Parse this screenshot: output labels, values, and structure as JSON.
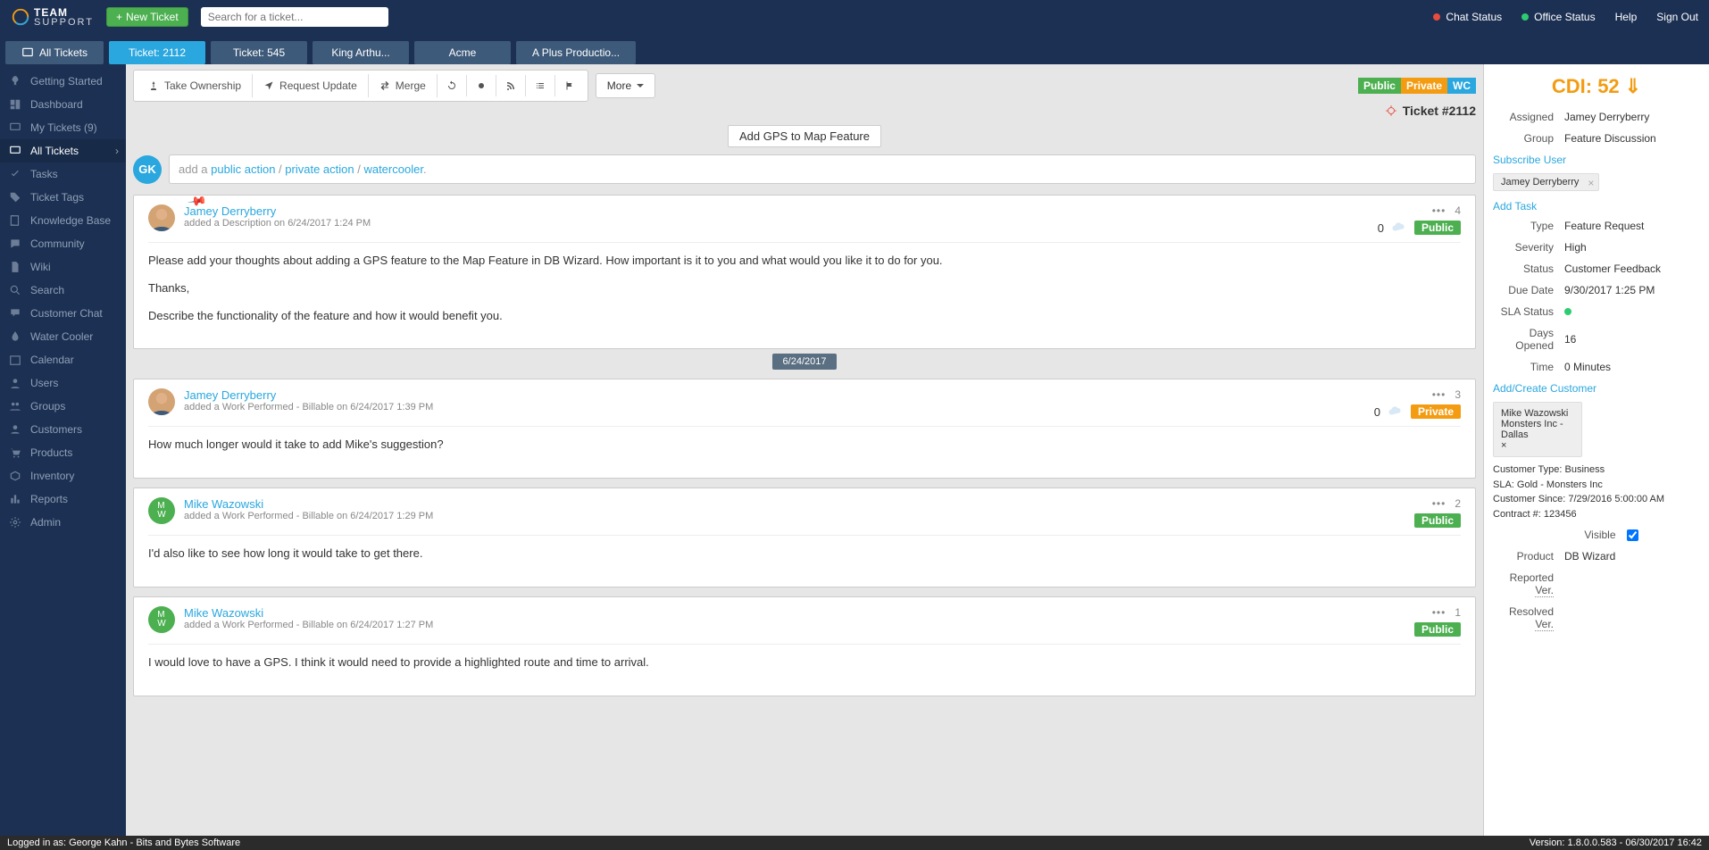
{
  "header": {
    "new_ticket": "New Ticket",
    "search_placeholder": "Search for a ticket...",
    "chat_status": "Chat Status",
    "office_status": "Office Status",
    "help": "Help",
    "signout": "Sign Out"
  },
  "tabs": [
    {
      "label": "All Tickets",
      "active": false,
      "icon": true
    },
    {
      "label": "Ticket: 2112",
      "active": true
    },
    {
      "label": "Ticket: 545",
      "active": false
    },
    {
      "label": "King Arthu...",
      "active": false
    },
    {
      "label": "Acme",
      "active": false
    },
    {
      "label": "A Plus Productio...",
      "active": false
    }
  ],
  "sidebar": [
    {
      "label": "Getting Started",
      "icon": "rocket"
    },
    {
      "label": "Dashboard",
      "icon": "dash"
    },
    {
      "label": "My Tickets (9)",
      "icon": "monitor"
    },
    {
      "label": "All Tickets",
      "icon": "monitor",
      "active": true
    },
    {
      "label": "Tasks",
      "icon": "check"
    },
    {
      "label": "Ticket Tags",
      "icon": "tag"
    },
    {
      "label": "Knowledge Base",
      "icon": "book"
    },
    {
      "label": "Community",
      "icon": "comment"
    },
    {
      "label": "Wiki",
      "icon": "file"
    },
    {
      "label": "Search",
      "icon": "search"
    },
    {
      "label": "Customer Chat",
      "icon": "chat"
    },
    {
      "label": "Water Cooler",
      "icon": "drop"
    },
    {
      "label": "Calendar",
      "icon": "cal"
    },
    {
      "label": "Users",
      "icon": "user"
    },
    {
      "label": "Groups",
      "icon": "group"
    },
    {
      "label": "Customers",
      "icon": "cust"
    },
    {
      "label": "Products",
      "icon": "cart"
    },
    {
      "label": "Inventory",
      "icon": "inv"
    },
    {
      "label": "Reports",
      "icon": "bar"
    },
    {
      "label": "Admin",
      "icon": "gear"
    }
  ],
  "toolbar": {
    "take_ownership": "Take Ownership",
    "request_update": "Request Update",
    "merge": "Merge",
    "more": "More"
  },
  "status_tags": {
    "public": "Public",
    "private": "Private",
    "wc": "WC"
  },
  "ticket_id": "Ticket #2112",
  "ticket_title": "Add GPS to Map Feature",
  "add_action": {
    "prefix": "add a ",
    "public": "public action",
    "sep1": " / ",
    "private": "private action",
    "sep2": " / ",
    "wc": "watercooler",
    "suffix": "."
  },
  "avatar_initials": "GK",
  "date_sep": "6/24/2017",
  "comments": [
    {
      "author": "Jamey Derryberry",
      "meta": "added a Description on 6/24/2017 1:24 PM",
      "count": "4",
      "votes": "0",
      "badge": "public",
      "avatar": "photo",
      "pinned": true,
      "body": [
        "Please add your thoughts about adding a GPS feature to the Map Feature in DB Wizard.  How important is it to you and what would you like it to do for you.",
        "Thanks,",
        "Describe the functionality of the feature and how it would benefit you."
      ]
    },
    {
      "author": "Jamey Derryberry",
      "meta": "added a Work Performed - Billable on 6/24/2017 1:39 PM",
      "count": "3",
      "votes": "0",
      "badge": "private",
      "avatar": "photo",
      "body": [
        "How much longer would it take to add Mike's suggestion?"
      ]
    },
    {
      "author": "Mike Wazowski",
      "meta": "added a Work Performed - Billable on 6/24/2017 1:29 PM",
      "count": "2",
      "badge": "public",
      "avatar": "MW",
      "body": [
        "I'd also like to see how long it would take to get there."
      ]
    },
    {
      "author": "Mike Wazowski",
      "meta": "added a Work Performed - Billable on 6/24/2017 1:27 PM",
      "count": "1",
      "badge": "public",
      "avatar": "MW",
      "body": [
        "I would love to have a GPS.  I think it would need to provide a highlighted route and time to arrival."
      ]
    }
  ],
  "right": {
    "cdi": "CDI: 52",
    "assigned_l": "Assigned",
    "assigned_v": "Jamey Derryberry",
    "group_l": "Group",
    "group_v": "Feature Discussion",
    "subscribe": "Subscribe User",
    "sub_chip": "Jamey Derryberry",
    "add_task": "Add Task",
    "type_l": "Type",
    "type_v": "Feature Request",
    "severity_l": "Severity",
    "severity_v": "High",
    "status_l": "Status",
    "status_v": "Customer Feedback",
    "due_l": "Due Date",
    "due_v": "9/30/2017 1:25 PM",
    "sla_l": "SLA Status",
    "days_l": "Days Opened",
    "days_v": "16",
    "time_l": "Time",
    "time_v": "0 Minutes",
    "add_cust": "Add/Create Customer",
    "cust_name": "Mike Wazowski",
    "cust_co": "Monsters Inc - Dallas",
    "cust_type": "Customer Type: Business",
    "cust_sla": "SLA: Gold - Monsters Inc",
    "cust_since": "Customer Since: 7/29/2016 5:00:00 AM",
    "cust_contract": "Contract #: 123456",
    "visible_l": "Visible",
    "product_l": "Product",
    "product_v": "DB Wizard",
    "reported_l": "Reported ",
    "reported_v": "Ver.",
    "resolved_l": "Resolved ",
    "resolved_v": "Ver."
  },
  "footer": {
    "left": "Logged in as: George Kahn - Bits and Bytes Software",
    "right": "Version: 1.8.0.0.583 - 06/30/2017 16:42"
  }
}
